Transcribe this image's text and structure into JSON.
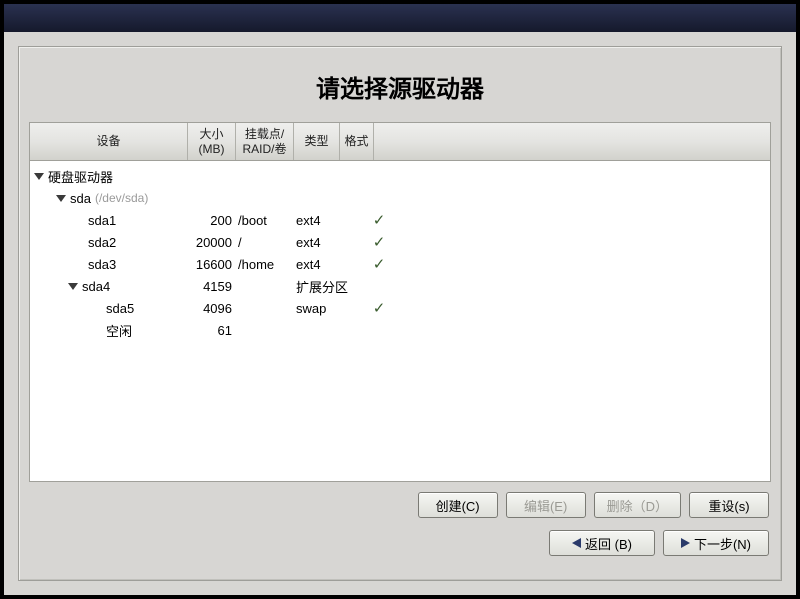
{
  "title": "请选择源驱动器",
  "columns": {
    "device": "设备",
    "size": "大小 (MB)",
    "mount": "挂载点/ RAID/卷",
    "type": "类型",
    "format": "格式"
  },
  "hardDrivesLabel": "硬盘驱动器",
  "drive": {
    "name": "sda",
    "path": "(/dev/sda)"
  },
  "partitions": [
    {
      "name": "sda1",
      "size": "200",
      "mount": "/boot",
      "type": "ext4",
      "fmt": true,
      "indent": 3
    },
    {
      "name": "sda2",
      "size": "20000",
      "mount": "/",
      "type": "ext4",
      "fmt": true,
      "indent": 3
    },
    {
      "name": "sda3",
      "size": "16600",
      "mount": "/home",
      "type": "ext4",
      "fmt": true,
      "indent": 3
    },
    {
      "name": "sda4",
      "size": "4159",
      "mount": "",
      "type": "扩展分区",
      "fmt": false,
      "indent": 3,
      "expander": true
    },
    {
      "name": "sda5",
      "size": "4096",
      "mount": "",
      "type": "swap",
      "fmt": true,
      "indent": 4
    },
    {
      "name": "空闲",
      "size": "61",
      "mount": "",
      "type": "",
      "fmt": false,
      "indent": 4
    }
  ],
  "buttons": {
    "create": "创建(C)",
    "edit": "编辑(E)",
    "delete": "删除（D）",
    "reset": "重设(s)",
    "back": "返回 (B)",
    "next": "下一步(N)"
  }
}
